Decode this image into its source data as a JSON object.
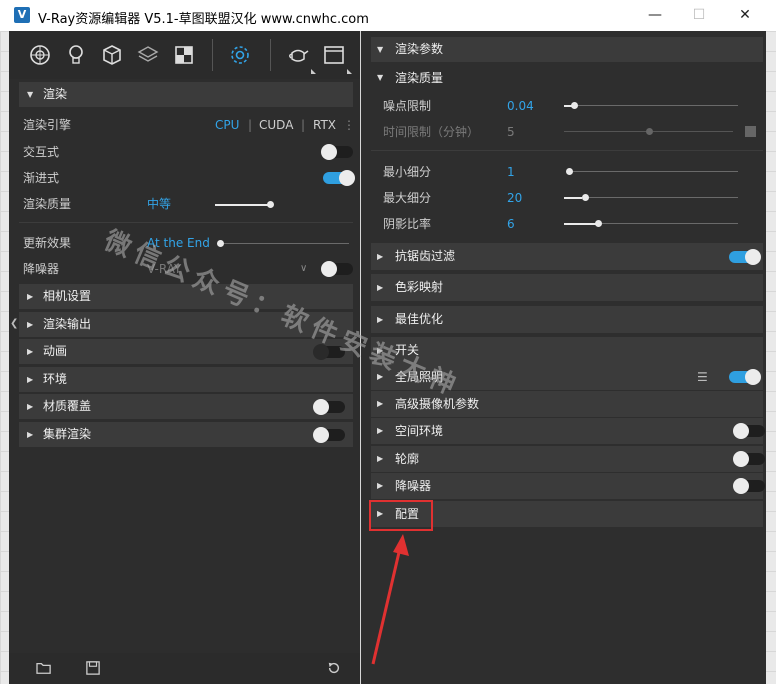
{
  "window": {
    "title": "V-Ray资源编辑器 V5.1-草图联盟汉化 www.cnwhc.com",
    "app_icon": "V",
    "buttons": {
      "minimize": "—",
      "maximize": "☐",
      "close": "✕"
    }
  },
  "toolbar": {
    "icons": [
      "materials-icon",
      "lights-icon",
      "geometry-icon",
      "layers-icon",
      "textures-icon",
      "settings-icon",
      "render-teapot-icon",
      "frame-buffer-icon"
    ]
  },
  "left": {
    "render_header": "渲染",
    "engine": {
      "label": "渲染引擎",
      "options": [
        "CPU",
        "CUDA",
        "RTX"
      ],
      "selected": "CPU"
    },
    "interactive": {
      "label": "交互式",
      "on": false
    },
    "progressive": {
      "label": "渐进式",
      "on": true
    },
    "quality": {
      "label": "渲染质量",
      "value": "中等"
    },
    "update_effects": {
      "label": "更新效果",
      "value": "At the End"
    },
    "denoiser": {
      "label": "降噪器",
      "value": "V-RAY",
      "on": false
    },
    "sections": [
      {
        "label": "相机设置",
        "toggle": null
      },
      {
        "label": "渲染输出",
        "toggle": null
      },
      {
        "label": "动画",
        "toggle": false
      },
      {
        "label": "环境",
        "toggle": null
      },
      {
        "label": "材质覆盖",
        "toggle": false
      },
      {
        "label": "集群渲染",
        "toggle": false
      }
    ]
  },
  "right": {
    "render_params_header": "渲染参数",
    "render_quality_header": "渲染质量",
    "noise_limit": {
      "label": "噪点限制",
      "value": "0.04"
    },
    "time_limit": {
      "label": "时间限制（分钟）",
      "value": "5"
    },
    "min_subdivs": {
      "label": "最小细分",
      "value": "1"
    },
    "max_subdivs": {
      "label": "最大细分",
      "value": "20"
    },
    "shade_rate": {
      "label": "阴影比率",
      "value": "6"
    },
    "sections": [
      {
        "label": "抗锯齿过滤",
        "toggle": true
      },
      {
        "label": "色彩映射",
        "toggle": null
      },
      {
        "label": "最佳优化",
        "toggle": null
      },
      {
        "label": "开关",
        "toggle": null
      },
      {
        "label": "全局照明",
        "toggle": true
      },
      {
        "label": "高级摄像机参数",
        "toggle": null
      },
      {
        "label": "空间环境",
        "toggle": false
      },
      {
        "label": "轮廓",
        "toggle": false
      },
      {
        "label": "降噪器",
        "toggle": false
      },
      {
        "label": "配置",
        "toggle": null
      }
    ]
  },
  "watermark": "微信公众号：软件安装大神",
  "colors": {
    "accent": "#32a4e8",
    "highlight": "#e03131",
    "panel": "#2d2d2d"
  }
}
